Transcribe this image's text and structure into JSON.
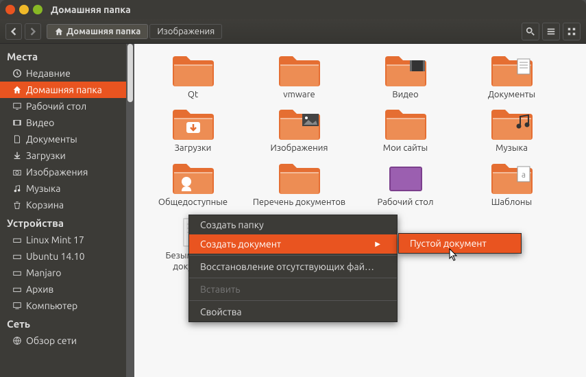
{
  "window": {
    "title": "Домашняя папка"
  },
  "toolbar": {
    "path_home": "Домашняя папка",
    "path_images": "Изображения"
  },
  "sidebar": {
    "sections": {
      "places": {
        "title": "Места",
        "items": [
          "Недавние",
          "Домашняя папка",
          "Рабочий стол",
          "Видео",
          "Документы",
          "Загрузки",
          "Изображения",
          "Музыка",
          "Корзина"
        ]
      },
      "devices": {
        "title": "Устройства",
        "items": [
          "Linux Mint 17",
          "Ubuntu 14.10",
          "Manjaro",
          "Архив",
          "Компьютер"
        ]
      },
      "network": {
        "title": "Сеть",
        "items": [
          "Обзор сети"
        ]
      }
    }
  },
  "items": [
    {
      "label": "Qt",
      "type": "folder"
    },
    {
      "label": "vmware",
      "type": "folder"
    },
    {
      "label": "Видео",
      "type": "folder-video"
    },
    {
      "label": "Документы",
      "type": "folder-doc"
    },
    {
      "label": "Загрузки",
      "type": "folder-down"
    },
    {
      "label": "Изображения",
      "type": "folder-img"
    },
    {
      "label": "Мои сайты",
      "type": "folder"
    },
    {
      "label": "Музыка",
      "type": "folder-music"
    },
    {
      "label": "Общедоступные",
      "type": "folder-share"
    },
    {
      "label": "Перечень документов",
      "type": "folder"
    },
    {
      "label": "Рабочий стол",
      "type": "desktop"
    },
    {
      "label": "Шаблоны",
      "type": "folder-tpl"
    },
    {
      "label": "Безымянный документ",
      "type": "file"
    }
  ],
  "context_menu": {
    "items": [
      {
        "label": "Создать папку"
      },
      {
        "label": "Создать документ",
        "hover": true,
        "submenu": true
      },
      {
        "label": "Восстановление отсутствующих фай…"
      },
      {
        "label": "Вставить",
        "disabled": true
      },
      {
        "label": "Свойства"
      }
    ],
    "submenu": {
      "items": [
        {
          "label": "Пустой документ",
          "hover": true
        }
      ]
    }
  }
}
